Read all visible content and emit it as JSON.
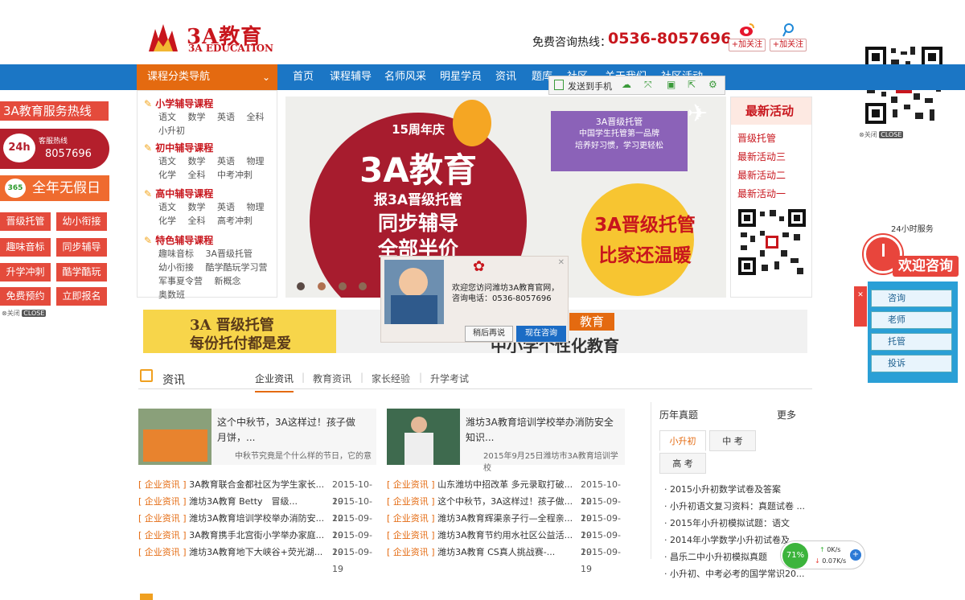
{
  "header": {
    "logo_cn": "3A教育",
    "logo_en": "3A EDUCATION",
    "hotline_label": "免费咨询热线：",
    "hotline_number": "0536-8057696",
    "follow_weibo": "+加关注",
    "follow_tencent": "+加关注"
  },
  "nav": {
    "category_label": "课程分类导航",
    "items": [
      "首页",
      "课程辅导",
      "名师风采",
      "明星学员",
      "资讯",
      "题库",
      "社区",
      "关于我们",
      "社区活动"
    ]
  },
  "toolbar": {
    "send_label": "发送到手机"
  },
  "left_hotline": {
    "title": "3A教育服务热线",
    "badge": "24h",
    "phone_label": "客服热线",
    "phone": "8057696",
    "year_badge": "365",
    "year_label": "全年无假日",
    "buttons": [
      "晋级托管",
      "幼小衔接",
      "趣味音标",
      "同步辅导",
      "升学冲刺",
      "酷学酷玩",
      "免费预约",
      "立即报名"
    ],
    "close": "关闭",
    "close_tag": "CLOSE"
  },
  "categories": [
    {
      "title": "小学辅导课程",
      "items": [
        "语文",
        "数学",
        "英语",
        "全科",
        "小升初"
      ]
    },
    {
      "title": "初中辅导课程",
      "items": [
        "语文",
        "数学",
        "英语",
        "物理",
        "化学",
        "全科",
        "中考冲刺"
      ]
    },
    {
      "title": "高中辅导课程",
      "items": [
        "语文",
        "数学",
        "英语",
        "物理",
        "化学",
        "全科",
        "高考冲刺"
      ]
    },
    {
      "title": "特色辅导课程",
      "items": [
        "趣味音标",
        "3A晋级托管",
        "幼小衔接",
        "酷学酷玩学习营",
        "军事夏令营",
        "新概念",
        "奥数班"
      ]
    }
  ],
  "banner": {
    "anniv": "15周年庆",
    "brand": "3A教育",
    "line1": "报3A晋级托管",
    "line2": "同步辅导",
    "line3": "全部半价",
    "purple_title": "3A晋级托管",
    "purple_l1": "中国学生托管第一品牌",
    "purple_l2": "培养好习惯，学习更轻松",
    "sun_l1": "3A晋级托管",
    "sun_l2": "比家还温暖"
  },
  "latest": {
    "title": "最新活动",
    "items": [
      "晋级托管",
      "最新活动三",
      "最新活动二",
      "最新活动一"
    ]
  },
  "qr_close": "关闭",
  "qr_close_tag": "CLOSE",
  "bottom_banner": {
    "left_l1": "3A 晋级托管",
    "left_l2": "每份托付都是爱",
    "right_tag": "教育",
    "right_text": "中小学个性化教育"
  },
  "popup": {
    "text1": "欢迎您访问潍坊3A教育官网，",
    "text2": "咨询电话：0536-8057696",
    "later": "稍后再说",
    "now": "现在咨询"
  },
  "news": {
    "title": "资讯",
    "tabs": [
      "企业资讯",
      "教育资讯",
      "家长经验",
      "升学考试"
    ],
    "featured": [
      {
        "title": "这个中秋节，3A这样过！孩子做月饼，...",
        "summary": "中秋节究竟是个什么样的节日，它的意"
      },
      {
        "title": "潍坊3A教育培训学校举办消防安全知识...",
        "summary": "2015年9月25日潍坊市3A教育培训学校"
      }
    ],
    "left_list": [
      {
        "tag": "[ 企业资讯 ]",
        "title": "3A教育联合金都社区为学生家长...",
        "date": "2015-10-19"
      },
      {
        "tag": "[ 企业资讯 ]",
        "title": "潍坊3A教育 Betty　冒级...",
        "date": "2015-10-12"
      },
      {
        "tag": "[ 企业资讯 ]",
        "title": "潍坊3A教育培训学校举办消防安...",
        "date": "2015-09-19"
      },
      {
        "tag": "[ 企业资讯 ]",
        "title": "3A教育携手北宫街小学举办家庭...",
        "date": "2015-09-19"
      },
      {
        "tag": "[ 企业资讯 ]",
        "title": "潍坊3A教育地下大峡谷+荧光湖...",
        "date": "2015-09-19"
      }
    ],
    "right_list": [
      {
        "tag": "[ 企业资讯 ]",
        "title": "山东潍坊中招改革 多元录取打破...",
        "date": "2015-10-12"
      },
      {
        "tag": "[ 企业资讯 ]",
        "title": "这个中秋节，3A这样过！孩子做...",
        "date": "2015-09-19"
      },
      {
        "tag": "[ 企业资讯 ]",
        "title": "潍坊3A教育辉渠亲子行—全程亲...",
        "date": "2015-09-19"
      },
      {
        "tag": "[ 企业资讯 ]",
        "title": "潍坊3A教育节约用水社区公益活...",
        "date": "2015-09-19"
      },
      {
        "tag": "[ 企业资讯 ]",
        "title": "潍坊3A教育 CS真人挑战赛-...",
        "date": "2015-09-19"
      }
    ]
  },
  "exam": {
    "title": "历年真题",
    "more": "更多",
    "tabs": [
      "小升初",
      "中 考",
      "高 考"
    ],
    "items": [
      "· 2015小升初数学试卷及答案",
      "· 小升初语文复习资料：真题试卷 ...",
      "· 2015年小升初模拟试题：语文",
      "· 2014年小学数学小升初试卷及...",
      "· 昌乐二中小升初模拟真题",
      "· 小升初、中考必考的国学常识20..."
    ]
  },
  "welcome": {
    "badge": "24小时服务",
    "title": "欢迎咨询",
    "buttons": [
      "咨询",
      "老师",
      "托管",
      "投诉"
    ]
  },
  "speed": {
    "percent": "71%",
    "up": "0K/s",
    "down": "0.07K/s"
  },
  "colors": {
    "brand_red": "#c8161d",
    "nav_blue": "#1b76c5",
    "nav_orange": "#e46a10"
  }
}
